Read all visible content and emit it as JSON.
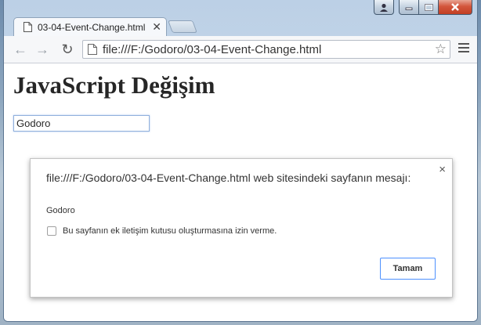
{
  "window": {
    "controls": {
      "user": "user-icon",
      "minimize": "minimize-icon",
      "maximize": "maximize-icon",
      "close": "close-icon"
    }
  },
  "tab": {
    "title": "03-04-Event-Change.html",
    "close": "✕"
  },
  "toolbar": {
    "back": "←",
    "forward": "→",
    "reload": "↻",
    "url": "file:///F:/Godoro/03-04-Event-Change.html",
    "star": "☆"
  },
  "page": {
    "heading": "JavaScript Değişim",
    "input_value": "Godoro"
  },
  "dialog": {
    "message": "file:///F:/Godoro/03-04-Event-Change.html web sitesindeki sayfanın mesajı:",
    "value": "Godoro",
    "checkbox_label": "Bu sayfanın ek iletişim kutusu oluşturmasına izin verme.",
    "ok_label": "Tamam",
    "close": "×"
  },
  "colors": {
    "accent": "#4d90fe",
    "close_button": "#c94a2f"
  }
}
